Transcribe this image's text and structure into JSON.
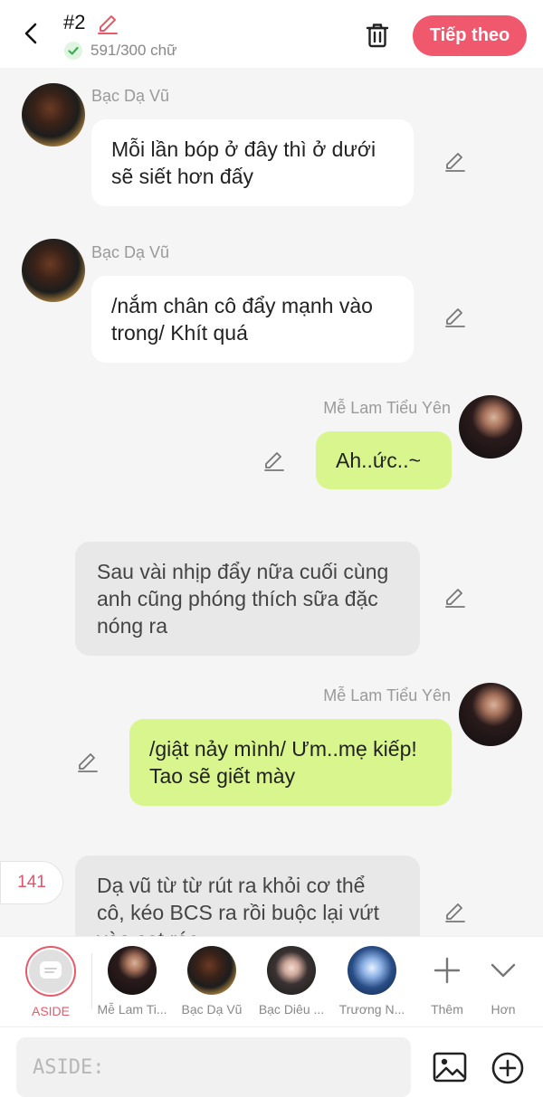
{
  "header": {
    "title": "#2",
    "word_count": "591/300 chữ",
    "next_label": "Tiếp theo"
  },
  "messages": [
    {
      "sender": "Bạc Dạ Vũ",
      "text": "Mỗi lần bóp ở đây thì ở dưới sẽ siết hơn đấy"
    },
    {
      "sender": "Bạc Dạ Vũ",
      "text": "/nắm chân cô đẩy mạnh vào trong/ Khít quá"
    },
    {
      "sender": "Mễ Lam Tiểu Yên",
      "text": "Ah..ức..~"
    },
    {
      "sender": "",
      "text": "Sau vài nhịp đẩy nữa cuối cùng anh cũng phóng thích sữa đặc nóng ra"
    },
    {
      "sender": "Mễ Lam Tiểu Yên",
      "text": "/giật nảy mình/ Ưm..mẹ kiếp! Tao sẽ giết mày"
    },
    {
      "sender": "",
      "text": "Dạ vũ từ từ rút ra khỏi cơ thể cô, kéo BCS ra rồi buộc lại vứt vào sọt rác"
    }
  ],
  "counter": "141",
  "characters": {
    "aside": "ASIDE",
    "items": [
      {
        "label": "Mễ Lam Ti..."
      },
      {
        "label": "Bạc Dạ Vũ"
      },
      {
        "label": "Bạc Diêu ..."
      },
      {
        "label": "Trương N..."
      }
    ],
    "add_label": "Thêm",
    "more_label": "Hơn"
  },
  "input": {
    "placeholder": "ASIDE:"
  },
  "colors": {
    "accent": "#f0586e",
    "green_bubble": "#d9f58d",
    "white_bubble": "#ffffff",
    "gray_bubble": "#e8e8e8"
  }
}
